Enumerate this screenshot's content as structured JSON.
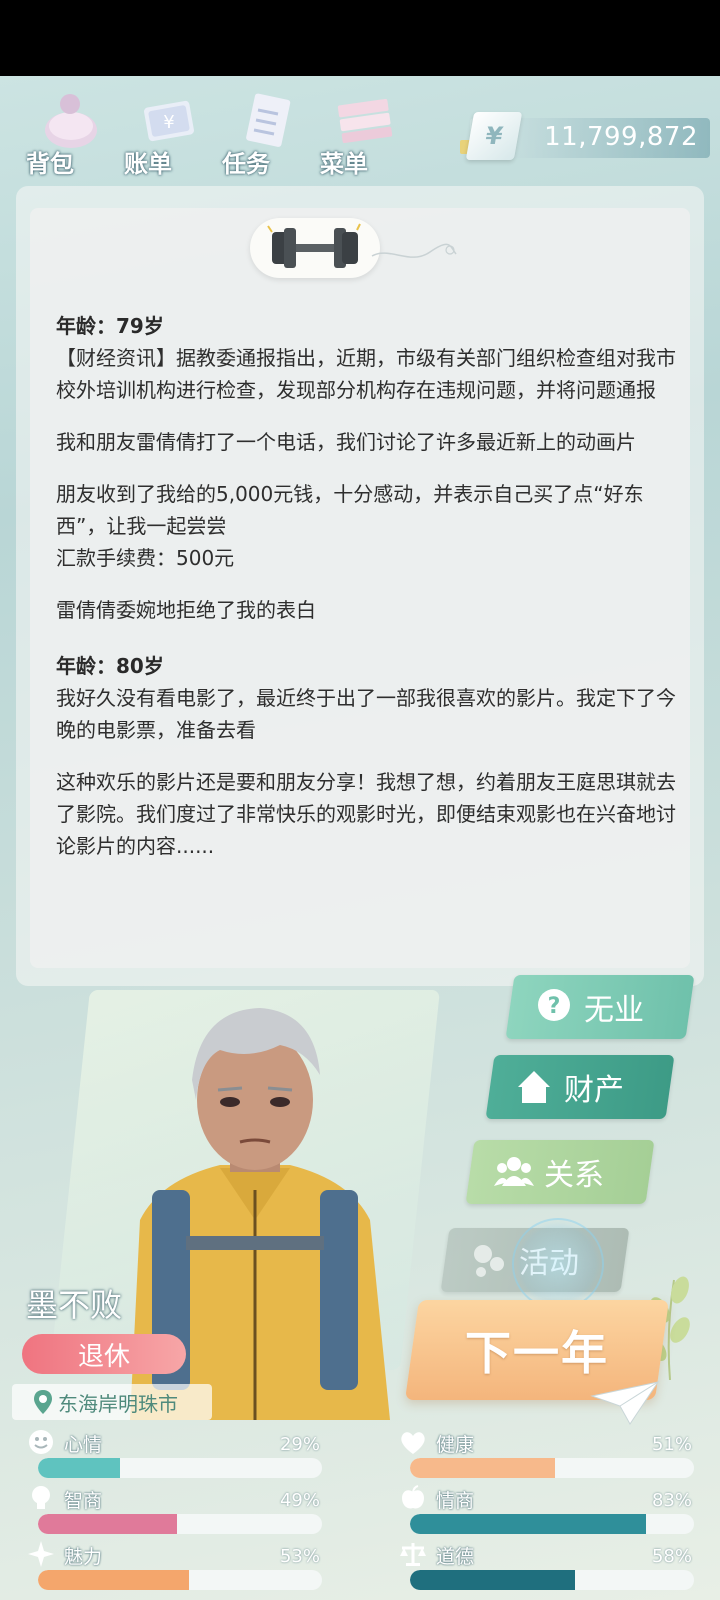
{
  "nav": {
    "items": [
      {
        "label": "背包",
        "icon": "backpack-icon"
      },
      {
        "label": "账单",
        "icon": "bill-icon"
      },
      {
        "label": "任务",
        "icon": "task-icon"
      },
      {
        "label": "菜单",
        "icon": "menu-icon"
      }
    ],
    "money": {
      "symbol": "¥",
      "value": "11,799,872"
    }
  },
  "log": {
    "entries": [
      {
        "age": "年龄：79岁",
        "paragraphs": [
          "【财经资讯】据教委通报指出，近期，市级有关部门组织检查组对我市校外培训机构进行检查，发现部分机构存在违规问题，并将问题通报",
          "我和朋友雷倩倩打了一个电话，我们讨论了许多最近新上的动画片",
          "朋友收到了我给的5,000元钱，十分感动，并表示自己买了点“好东西”，让我一起尝尝\n汇款手续费：500元",
          "雷倩倩委婉地拒绝了我的表白"
        ]
      },
      {
        "age": "年龄：80岁",
        "paragraphs": [
          "我好久没有看电影了，最近终于出了一部我很喜欢的影片。我定下了今晚的电影票，准备去看",
          "这种欢乐的影片还是要和朋友分享！我想了想，约着朋友王庭思琪就去了影院。我们度过了非常快乐的观影时光，即便结束观影也在兴奋地讨论影片的内容......"
        ]
      }
    ]
  },
  "side_buttons": {
    "job": "无业",
    "asset": "财产",
    "relation": "关系",
    "activity": "活动"
  },
  "next_year": "下一年",
  "character": {
    "name": "墨不败",
    "status": "退休",
    "location": "东海岸明珠市"
  },
  "stats": [
    {
      "label": "心情",
      "pct": "29%",
      "value": 29,
      "color": "#5fc3bf",
      "icon": "smile-icon"
    },
    {
      "label": "健康",
      "pct": "51%",
      "value": 51,
      "color": "#f7b98b",
      "icon": "heart-icon"
    },
    {
      "label": "智商",
      "pct": "49%",
      "value": 49,
      "color": "#e07a9a",
      "icon": "bulb-icon"
    },
    {
      "label": "情商",
      "pct": "83%",
      "value": 83,
      "color": "#2f8f9a",
      "icon": "apple-icon"
    },
    {
      "label": "魅力",
      "pct": "53%",
      "value": 53,
      "color": "#f4a66c",
      "icon": "sparkle-icon"
    },
    {
      "label": "道德",
      "pct": "58%",
      "value": 58,
      "color": "#1f6f7e",
      "icon": "scale-icon"
    }
  ]
}
